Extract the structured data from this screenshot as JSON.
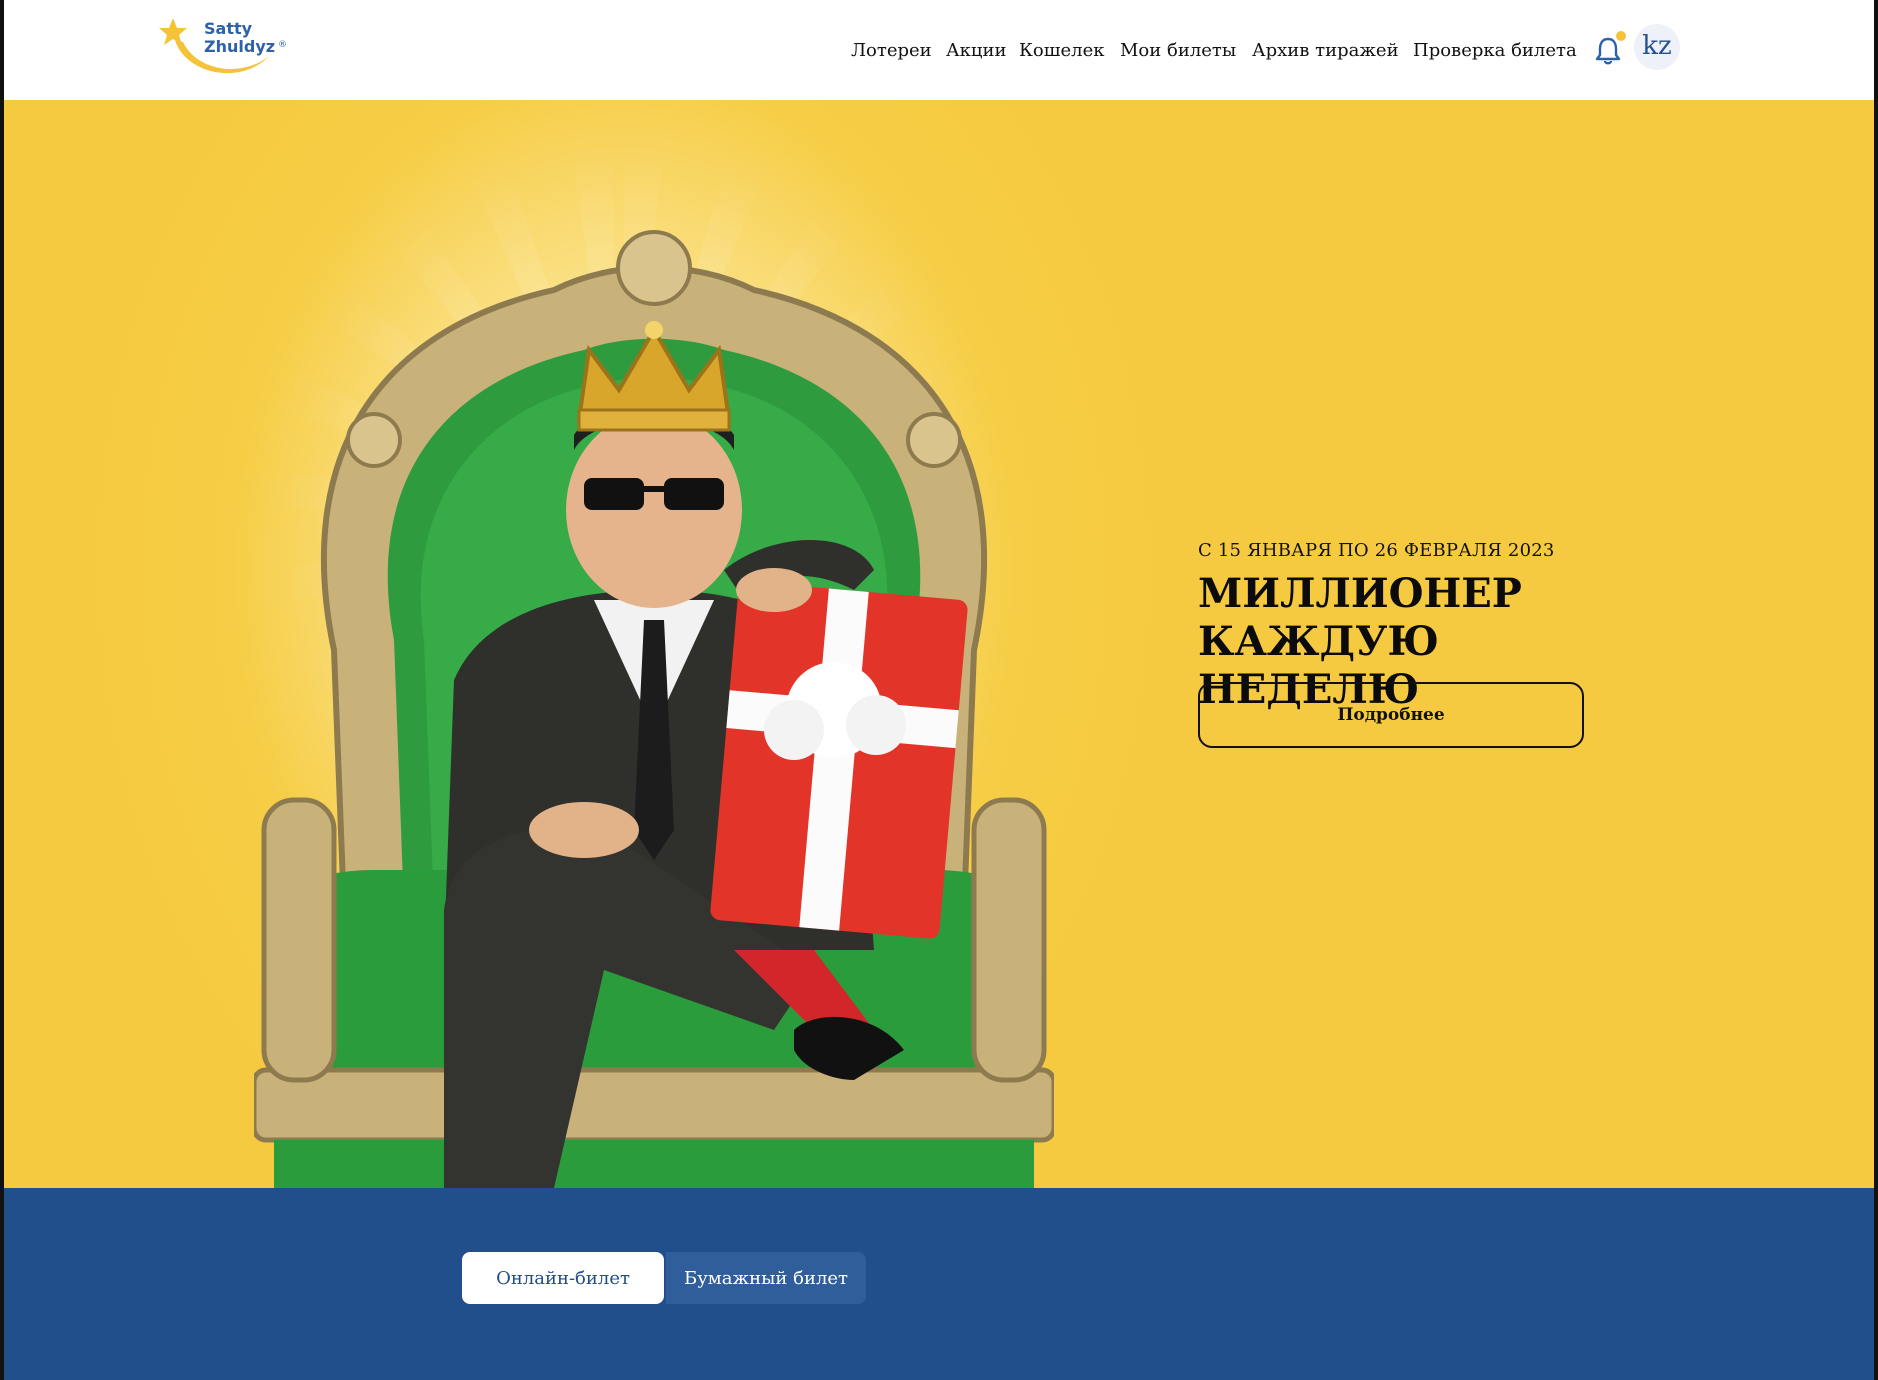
{
  "brand": {
    "line1": "Satty",
    "line2": "Zhuldyz",
    "mark": "®"
  },
  "nav": {
    "items": [
      {
        "label": "Лотереи"
      },
      {
        "label": "Акции"
      },
      {
        "label": "Кошелек"
      },
      {
        "label": "Мои билеты"
      },
      {
        "label": "Архив тиражей"
      },
      {
        "label": "Проверка билета"
      }
    ],
    "notifications_icon": "bell-icon",
    "language": "kz"
  },
  "hero": {
    "date": "С 15 ЯНВАРЯ ПО 26 ФЕВРАЛЯ 2023",
    "title_line1": "МИЛЛИОНЕР КАЖДУЮ",
    "title_line2": "НЕДЕЛЮ",
    "button": "Подробнее"
  },
  "tickets": {
    "tabs": [
      {
        "label": "Онлайн-билет",
        "active": true
      },
      {
        "label": "Бумажный билет",
        "active": false
      }
    ]
  },
  "colors": {
    "accent_yellow": "#f5ca40",
    "brand_blue": "#204f8b",
    "star_yellow": "#f5c33a"
  }
}
